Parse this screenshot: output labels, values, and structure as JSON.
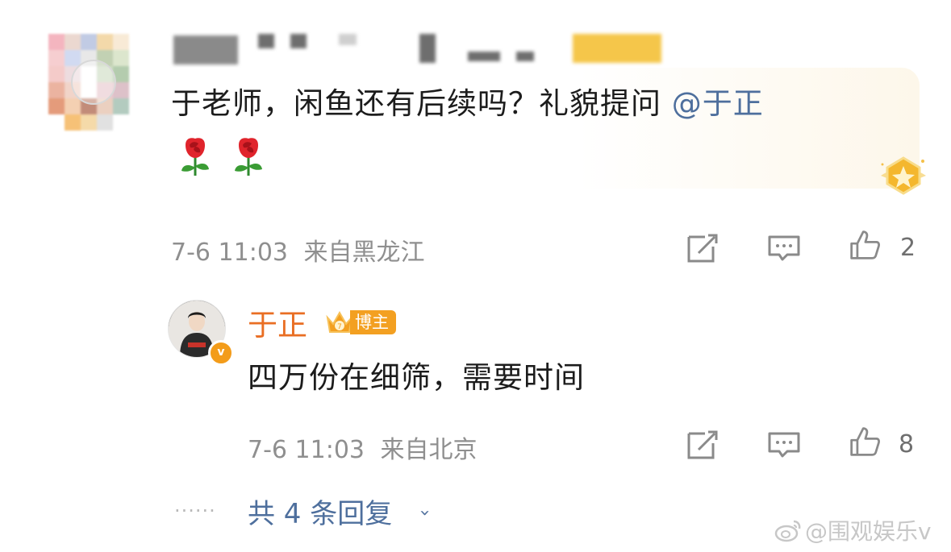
{
  "comment": {
    "text": "于老师，闲鱼还有后续吗？礼貌提问 ",
    "mention": "@于正",
    "emojis": [
      "rose-icon",
      "rose-icon"
    ],
    "time": "7-6 11:03",
    "location": "来自黑龙江",
    "like_count": "2"
  },
  "reply": {
    "author": "于正",
    "badge": "博主",
    "text": "四万份在细筛，需要时间",
    "time": "7-6 11:03",
    "location": "来自北京",
    "like_count": "8"
  },
  "more": {
    "dots": "······",
    "label": "共 4 条回复",
    "chevron": "›"
  },
  "watermark": {
    "text": "@围观娱乐v"
  },
  "colors": {
    "link": "#4e6f9d",
    "author_orange": "#e96e23",
    "badge_gold": "#f3a021",
    "meta_gray": "#8f8f8f"
  }
}
